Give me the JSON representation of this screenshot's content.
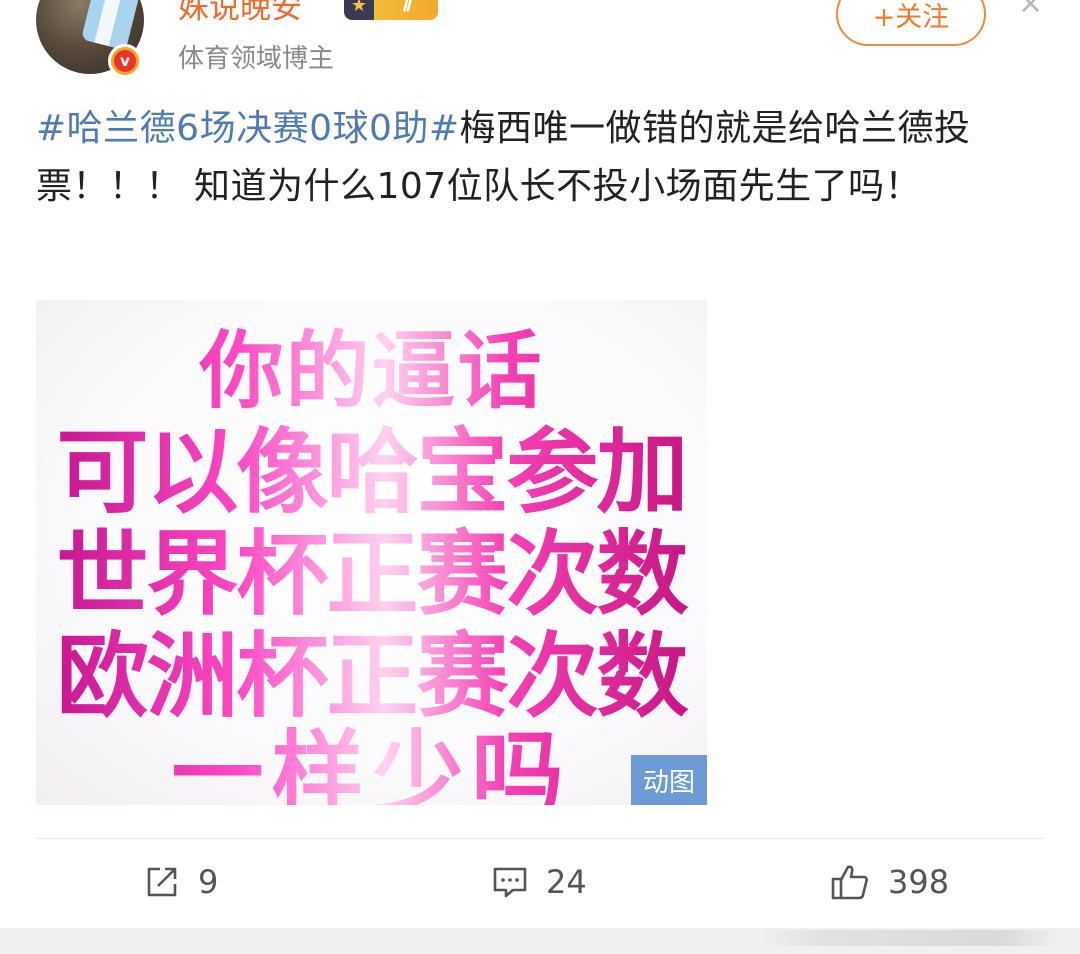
{
  "header": {
    "username": "姝说晚安",
    "level_badge": "Ⅱ",
    "subtitle": "体育领域博主",
    "follow_label": "+关注",
    "close_glyph": "×",
    "verified_glyph": "v",
    "star_glyph": "★"
  },
  "post": {
    "hashtag": "#哈兰德6场决赛0球0助#",
    "text": "梅西唯一做错的就是给哈兰德投票！！！ 知道为什么107位队长不投小场面先生了吗！"
  },
  "gif": {
    "lines": [
      "你的逼话",
      "可以像哈宝参加",
      "世界杯正赛次数",
      "欧洲杯正赛次数",
      "一样少吗"
    ],
    "badge": "动图"
  },
  "actions": {
    "repost_count": "9",
    "comment_count": "24",
    "like_count": "398"
  },
  "colors": {
    "username": "#f06b2a",
    "hashtag": "#4e7bb5",
    "follow": "#f07a2a",
    "gif_badge": "#6e9bd6"
  },
  "icons": {
    "repost": "share-icon",
    "comment": "comment-icon",
    "like": "thumbs-up-icon"
  }
}
